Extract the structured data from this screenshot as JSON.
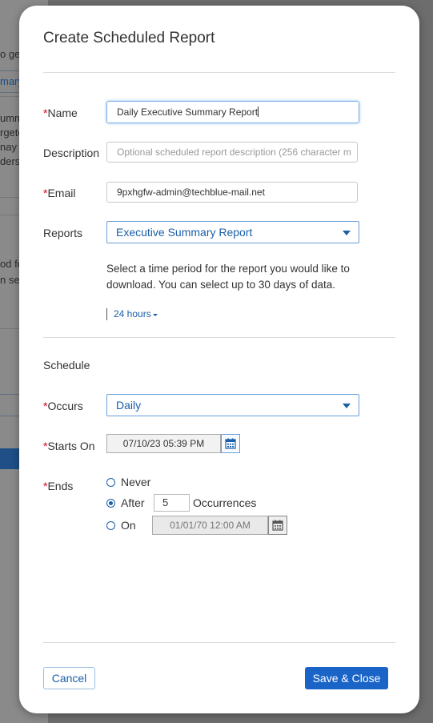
{
  "background": {
    "lines": [
      "o ge",
      "mary",
      "umm",
      "rgete",
      "nay h",
      "derst",
      "od fo",
      "n sel"
    ]
  },
  "modal": {
    "title": "Create Scheduled Report",
    "name_label": "Name",
    "name_value": "Daily Executive Summary Report",
    "description_label": "Description",
    "description_placeholder": "Optional scheduled report description (256 character m",
    "email_label": "Email",
    "email_value": "9pxhgfw-admin@techblue-mail.net",
    "reports_label": "Reports",
    "reports_selected": "Executive Summary Report",
    "help_text": "Select a time period for the report you would like to download. You can select up to 30 days of data.",
    "period_value": "24 hours",
    "schedule_heading": "Schedule",
    "occurs_label": "Occurs",
    "occurs_selected": "Daily",
    "starts_on_label": "Starts On",
    "starts_on_value": "07/10/23 05:39 PM",
    "ends_label": "Ends",
    "ends_options": {
      "never": "Never",
      "after": "After",
      "after_count": "5",
      "occurrences": "Occurrences",
      "on": "On",
      "on_date": "01/01/70 12:00 AM"
    },
    "ends_selected": "after",
    "required_marker": "*",
    "cancel_label": "Cancel",
    "save_label": "Save & Close"
  },
  "colors": {
    "accent": "#1a64c8",
    "link": "#1a5fa8",
    "required": "#d0021b"
  }
}
